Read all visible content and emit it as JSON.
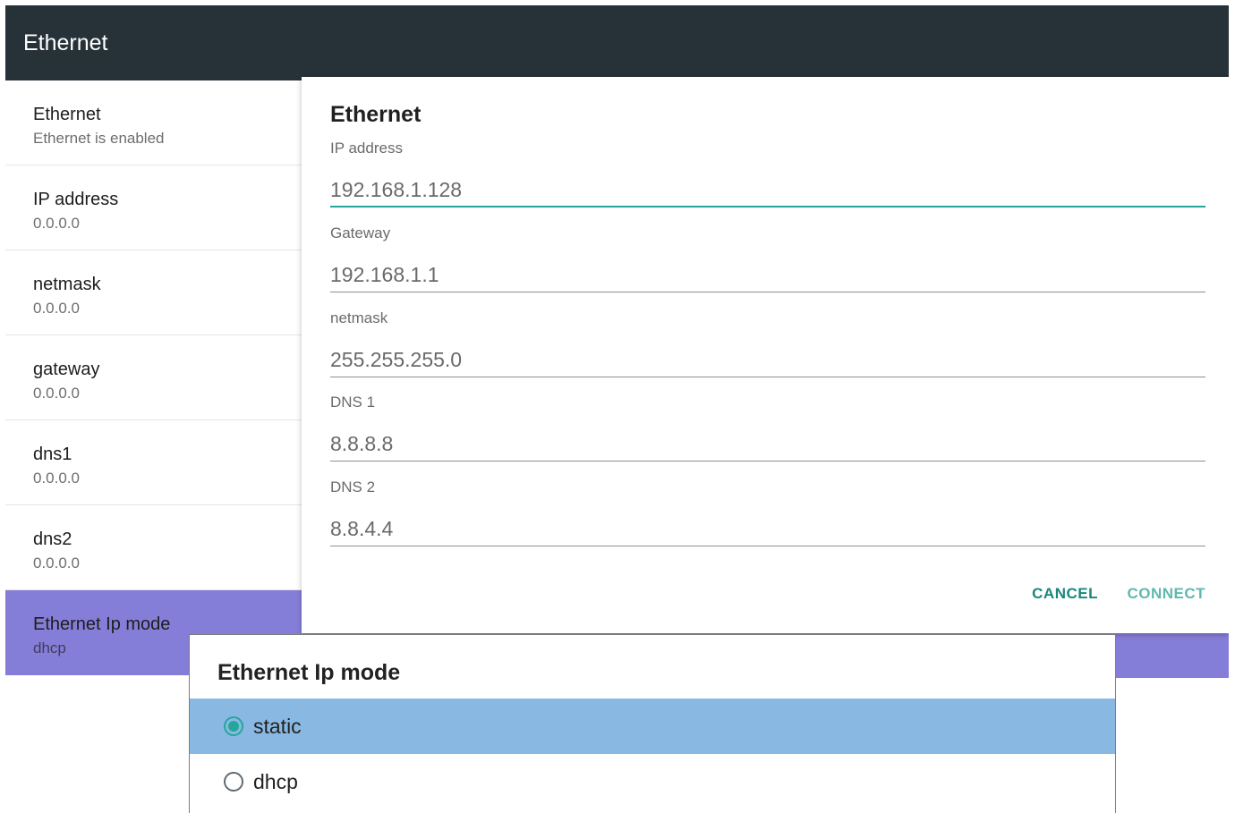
{
  "appbar": {
    "title": "Ethernet"
  },
  "sidebar": {
    "items": [
      {
        "title": "Ethernet",
        "subtitle": "Ethernet is enabled"
      },
      {
        "title": "IP address",
        "subtitle": "0.0.0.0"
      },
      {
        "title": "netmask",
        "subtitle": "0.0.0.0"
      },
      {
        "title": "gateway",
        "subtitle": "0.0.0.0"
      },
      {
        "title": "dns1",
        "subtitle": "0.0.0.0"
      },
      {
        "title": "dns2",
        "subtitle": "0.0.0.0"
      },
      {
        "title": "Ethernet Ip mode",
        "subtitle": "dhcp"
      }
    ]
  },
  "dialog": {
    "title": "Ethernet",
    "fields": [
      {
        "label": "IP address",
        "value": "192.168.1.128"
      },
      {
        "label": "Gateway",
        "value": "192.168.1.1"
      },
      {
        "label": "netmask",
        "value": "255.255.255.0"
      },
      {
        "label": "DNS 1",
        "value": "8.8.8.8"
      },
      {
        "label": "DNS 2",
        "value": "8.8.4.4"
      }
    ],
    "cancel_label": "CANCEL",
    "connect_label": "CONNECT"
  },
  "ipmode_popup": {
    "title": "Ethernet Ip mode",
    "options": [
      {
        "label": "static",
        "checked": true
      },
      {
        "label": "dhcp",
        "checked": false
      }
    ]
  },
  "colors": {
    "appbar": "#263238",
    "selected_item": "#857ed9",
    "accent": "#26a69a",
    "option_highlight": "#89b9e3"
  }
}
